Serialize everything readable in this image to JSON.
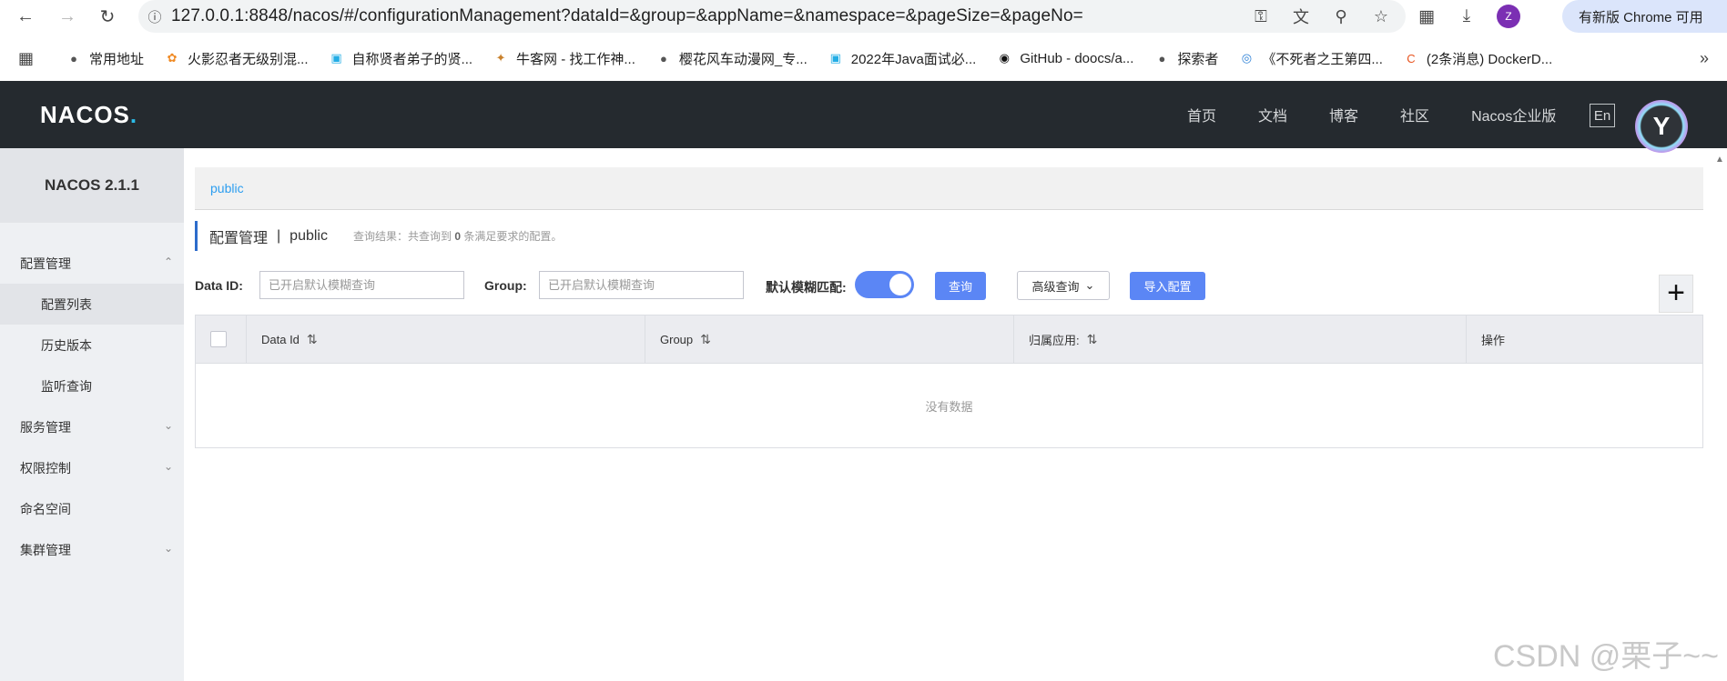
{
  "browser": {
    "url": "127.0.0.1:8848/nacos/#/configurationManagement?dataId=&group=&appName=&namespace=&pageSize=&pageNo=",
    "profile_initial": "Z",
    "update_label": "有新版 Chrome 可用",
    "bookmarks": [
      {
        "label": "常用地址",
        "icon": "globe-icon",
        "color": "#555555"
      },
      {
        "label": "火影忍者无级别混...",
        "icon": "flower-icon",
        "color": "#f08a24"
      },
      {
        "label": "自称贤者弟子的贤...",
        "icon": "bilibili-icon",
        "color": "#23ade5"
      },
      {
        "label": "牛客网 - 找工作神...",
        "icon": "nowcoder-icon",
        "color": "#c9822e"
      },
      {
        "label": "樱花风车动漫网_专...",
        "icon": "globe-icon",
        "color": "#555555"
      },
      {
        "label": "2022年Java面试必...",
        "icon": "bilibili-icon",
        "color": "#23ade5"
      },
      {
        "label": "GitHub - doocs/a...",
        "icon": "github-icon",
        "color": "#111111"
      },
      {
        "label": "探索者",
        "icon": "globe-icon",
        "color": "#555555"
      },
      {
        "label": "《不死者之王第四...",
        "icon": "eye-icon",
        "color": "#2a7fd6"
      },
      {
        "label": "(2条消息) DockerD...",
        "icon": "csdn-icon",
        "color": "#e8541f"
      }
    ]
  },
  "header": {
    "logo_text": "NACOS",
    "logo_dot": ".",
    "nav": [
      "首页",
      "文档",
      "博客",
      "社区",
      "Nacos企业版"
    ],
    "lang": "En"
  },
  "sidebar": {
    "version": "NACOS 2.1.1",
    "config_group": "配置管理",
    "config_items": [
      "配置列表",
      "历史版本",
      "监听查询"
    ],
    "service": "服务管理",
    "auth": "权限控制",
    "namespace": "命名空间",
    "cluster": "集群管理"
  },
  "main": {
    "namespace_tab": "public",
    "title": "配置管理",
    "title_ns": "public",
    "result_prefix": "查询结果：共查询到",
    "result_count": "0",
    "result_suffix": "条满足要求的配置。",
    "filters": {
      "data_id_label": "Data ID:",
      "data_id_placeholder": "已开启默认模糊查询",
      "data_id_value": "",
      "group_label": "Group:",
      "group_placeholder": "已开启默认模糊查询",
      "group_value": "",
      "fuzzy_label": "默认模糊匹配:",
      "fuzzy_on": true,
      "query_btn": "查询",
      "advanced_btn": "高级查询",
      "import_btn": "导入配置"
    },
    "table": {
      "columns": [
        "Data Id",
        "Group",
        "归属应用:",
        "操作"
      ],
      "rows": [],
      "empty_text": "没有数据"
    }
  },
  "watermark": "CSDN @栗子~~",
  "colors": {
    "primary": "#5b86f5",
    "header_bg": "#252a2f",
    "sidebar_bg": "#eef0f3",
    "link": "#2d9ef0"
  }
}
